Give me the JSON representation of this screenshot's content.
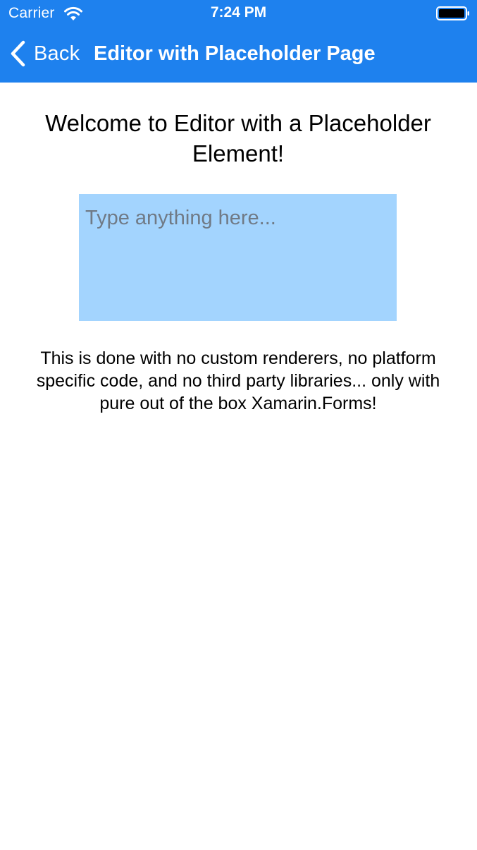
{
  "status_bar": {
    "carrier": "Carrier",
    "time": "7:24 PM",
    "icons": [
      "wifi-icon",
      "battery-icon"
    ]
  },
  "nav_bar": {
    "back_label": "Back",
    "back_icon": "chevron-left-icon",
    "title": "Editor with Placeholder Page"
  },
  "main": {
    "welcome_text": "Welcome to Editor with a Placeholder Element!",
    "editor": {
      "value": "",
      "placeholder": "Type anything here..."
    },
    "info_text": "This is done with no custom renderers, no platform specific code, and no third party libraries... only with pure out of the box Xamarin.Forms!"
  },
  "colors": {
    "nav_bar": "#1E81EE",
    "editor_background": "#A3D4FE",
    "placeholder_text": "#707A86",
    "page_background": "#FFFFFF"
  }
}
